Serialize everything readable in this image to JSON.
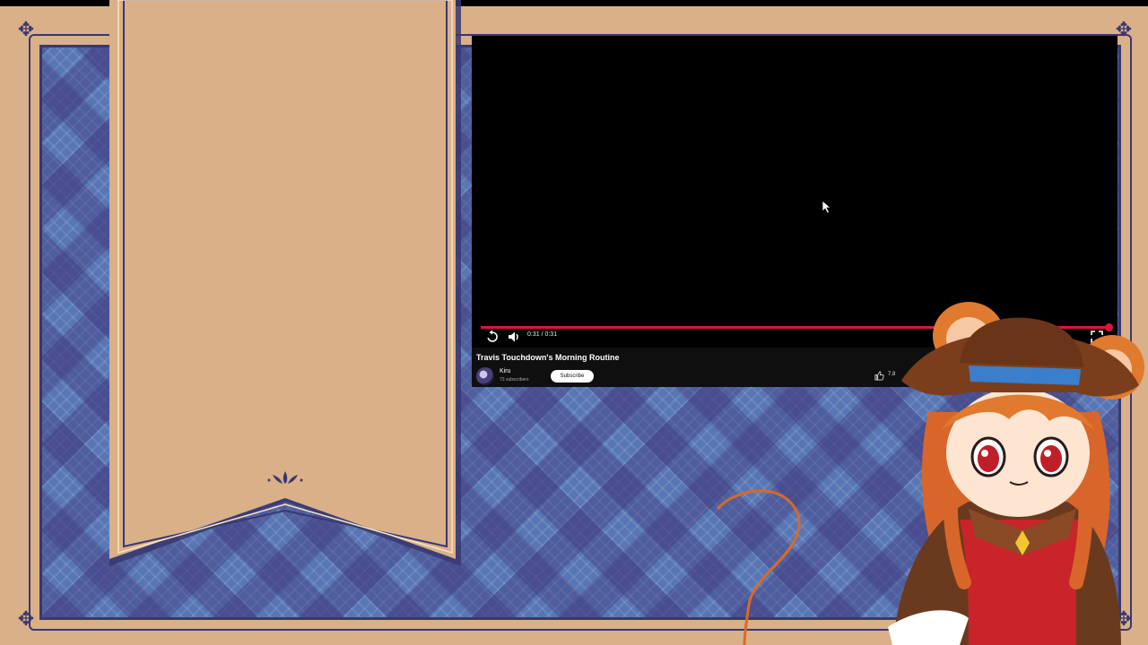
{
  "colors": {
    "frame": "#d9b088",
    "plaid_base": "#5876b4",
    "plaid_dark": "#3a3770",
    "progress": "#e0153a",
    "player_bg": "#000000",
    "info_bg": "#0f0f0f"
  },
  "player": {
    "time": "0:31 / 0:31",
    "progress_fraction": 1.0,
    "replay_icon": "replay-icon",
    "volume_icon": "volume-icon",
    "fullscreen_icon": "fullscreen-icon"
  },
  "video": {
    "title": "Travis Touchdown's Morning Routine",
    "channel": "Kiru",
    "subscribers": "73 subscribers",
    "subscribe_label": "Subscribe",
    "likes": "7.8",
    "like_icon": "thumbs-up-icon"
  },
  "decor": {
    "banner_ornament_icon": "fleur-icon",
    "corner_icon": "corner-ornament-icon",
    "character": "mouse-girl-cowboy-hat"
  }
}
